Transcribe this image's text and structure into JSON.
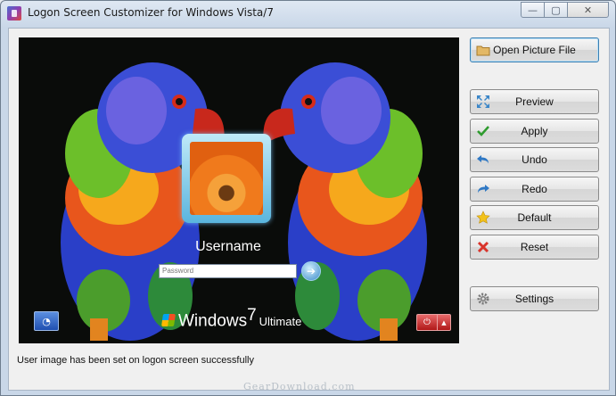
{
  "window": {
    "title": "Logon Screen Customizer for Windows Vista/7",
    "controls": {
      "minimize": "—",
      "maximize": "▢",
      "close": "✕"
    }
  },
  "preview": {
    "username": "Username",
    "password_placeholder": "Password",
    "go_glyph": "➔",
    "brand": {
      "windows": "Windows",
      "version": "7",
      "edition": "Ultimate"
    },
    "ease_glyph": "◔",
    "power_glyph": "⏻",
    "power_arrow": "▲"
  },
  "actions": {
    "open": "Open Picture File",
    "preview": "Preview",
    "apply": "Apply",
    "undo": "Undo",
    "redo": "Redo",
    "default": "Default",
    "reset": "Reset",
    "settings": "Settings"
  },
  "status": "User image has been set on logon screen successfully",
  "watermark": "GearDownload.com",
  "colors": {
    "accent": "#3c7fb1",
    "apply": "#2e9b2e",
    "reset": "#d9342b",
    "default": "#f2c21b",
    "undo": "#2f78c4"
  }
}
